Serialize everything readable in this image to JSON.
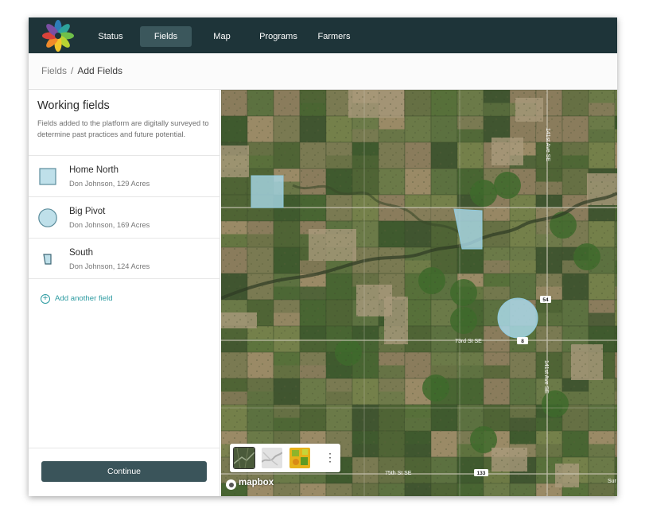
{
  "nav": {
    "items": [
      {
        "label": "Status",
        "active": false
      },
      {
        "label": "Fields",
        "active": true
      },
      {
        "label": "Map",
        "active": false
      },
      {
        "label": "Programs",
        "active": false
      },
      {
        "label": "Farmers",
        "active": false
      }
    ]
  },
  "breadcrumb": {
    "parent": "Fields",
    "separator": "/",
    "current": "Add Fields"
  },
  "sidebar": {
    "title": "Working fields",
    "description": "Fields added to the platform are digitally surveyed to determine past practices and future potential.",
    "fields": [
      {
        "name": "Home North",
        "meta": "Don Johnson, 129 Acres",
        "shape": "square-icon"
      },
      {
        "name": "Big Pivot",
        "meta": "Don Johnson, 169 Acres",
        "shape": "circle-icon"
      },
      {
        "name": "South",
        "meta": "Don Johnson, 124 Acres",
        "shape": "polygon-icon"
      }
    ],
    "add_label": "Add another field",
    "continue_label": "Continue"
  },
  "map": {
    "road_labels": {
      "ave_141_top": "141st Ave SE",
      "ave_141_bottom": "141st Ave SE",
      "st_73rd": "73rd St SE",
      "st_75th": "75th St SE",
      "edge": "Sur"
    },
    "route_shields": [
      "54",
      "8",
      "133"
    ],
    "layer_options": [
      "satellite-layer-icon",
      "terrain-layer-icon",
      "vegetation-layer-icon"
    ],
    "more_label": "⋮",
    "attribution": "mapbox"
  },
  "colors": {
    "header": "#1e3439",
    "nav_active": "#3b575c",
    "accent": "#2b9aa0",
    "button": "#3a545a",
    "field_fill": "#a8d8e8"
  }
}
